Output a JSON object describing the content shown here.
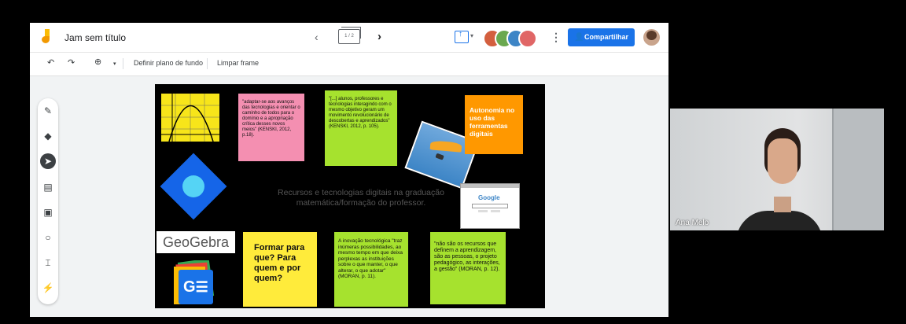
{
  "app": {
    "title": "Jam sem título",
    "frame_counter": "1 / 2",
    "share_label": "Compartilhar"
  },
  "toolbar": {
    "undo_icon": "undo-icon",
    "redo_icon": "redo-icon",
    "zoom_icon": "zoom-icon",
    "set_background_label": "Definir plano de fundo",
    "clear_frame_label": "Limpar frame"
  },
  "sidebar": {
    "tools": [
      "marker-icon",
      "eraser-icon",
      "select-icon",
      "sticky-note-icon",
      "image-icon",
      "shape-icon",
      "text-box-icon",
      "laser-icon"
    ]
  },
  "collaborators": [
    {
      "color": "#d35f3e"
    },
    {
      "color": "#6aa84f"
    },
    {
      "color": "#3d85c6"
    },
    {
      "color": "#e06666"
    }
  ],
  "frame": {
    "center_text": "Recursos e tecnologias digitais na graduação matemática/formação do professor.",
    "notes": [
      {
        "id": "kenski-2012-a",
        "color": "#f48fb1",
        "text": "\"adaptar-se aos avanços das tecnologias e orientar o caminho de todos para o domínio e a apropriação crítica desses novos meios\" (KENSKI, 2012, p.18)."
      },
      {
        "id": "kenski-2012-b",
        "color": "#a6e22e",
        "text": "\"[...] alunos, professores e tecnologias interagindo com o mesmo objetivo geram um movimento revolucionário de descobertas e aprendizados\" (KENSKI, 2012, p. 105)."
      },
      {
        "id": "autonomia",
        "color": "#ff9800",
        "text": "Autonomia no uso das ferramentas digitais"
      },
      {
        "id": "formar",
        "color": "#ffeb3b",
        "text": "Formar para que? Para quem e por quem?"
      },
      {
        "id": "moran-a",
        "color": "#a6e22e",
        "text": "A inovação tecnológica \"traz inúmeras possibilidades, ao mesmo tempo em que deixa perplexas as instituições sobre o que manter, o que alterar, o que adotar\" (MORAN, p. 11)."
      },
      {
        "id": "moran-b",
        "color": "#a6e22e",
        "text": "\"não são os recursos que definem a aprendizagem, são as pessoas, o projeto pedagógico, as interações, a gestão\" (MORAN, p. 12)."
      }
    ],
    "geogebra_text": "GeoGebra",
    "google_logo": "Google",
    "classroom_letters": "G"
  },
  "webcam": {
    "participant_name": "Ana Melo"
  }
}
